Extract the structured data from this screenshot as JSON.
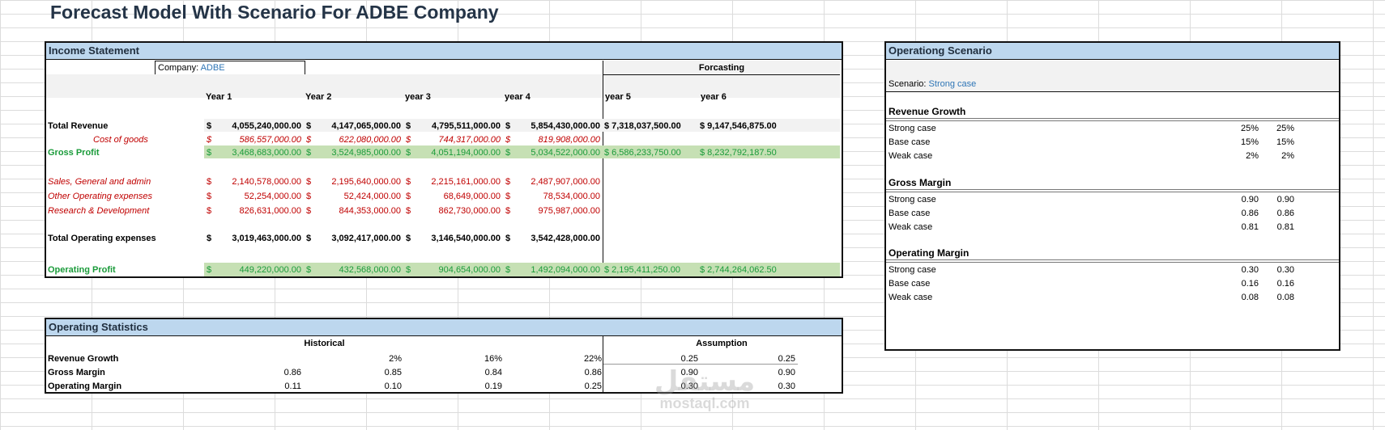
{
  "title": "Forecast Model With Scenario For ADBE Company",
  "income": {
    "header": "Income Statement",
    "company_label": "Company:",
    "company_value": "ADBE",
    "forecasting_label": "Forcasting",
    "years": [
      "Year 1",
      "Year 2",
      "year 3",
      "year 4",
      "year 5",
      "year 6"
    ],
    "rows": {
      "total_revenue": {
        "label": "Total Revenue",
        "values": [
          "4,055,240,000.00",
          "4,147,065,000.00",
          "4,795,511,000.00",
          "5,854,430,000.00",
          "7,318,037,500.00",
          "9,147,546,875.00"
        ]
      },
      "cost_of_goods": {
        "label": "Cost of goods",
        "values": [
          "586,557,000.00",
          "622,080,000.00",
          "744,317,000.00",
          "819,908,000.00"
        ]
      },
      "gross_profit": {
        "label": "Gross Profit",
        "values": [
          "3,468,683,000.00",
          "3,524,985,000.00",
          "4,051,194,000.00",
          "5,034,522,000.00",
          "6,586,233,750.00",
          "8,232,792,187.50"
        ]
      },
      "sga": {
        "label": "Sales, General and admin",
        "values": [
          "2,140,578,000.00",
          "2,195,640,000.00",
          "2,215,161,000.00",
          "2,487,907,000.00"
        ]
      },
      "other_opex": {
        "label": "Other Operating expenses",
        "values": [
          "52,254,000.00",
          "52,424,000.00",
          "68,649,000.00",
          "78,534,000.00"
        ]
      },
      "rnd": {
        "label": "Research & Development",
        "values": [
          "826,631,000.00",
          "844,353,000.00",
          "862,730,000.00",
          "975,987,000.00"
        ]
      },
      "total_opex": {
        "label": "Total Operating expenses",
        "values": [
          "3,019,463,000.00",
          "3,092,417,000.00",
          "3,146,540,000.00",
          "3,542,428,000.00"
        ]
      },
      "operating_profit": {
        "label": "Operating Profit",
        "values": [
          "449,220,000.00",
          "432,568,000.00",
          "904,654,000.00",
          "1,492,094,000.00",
          "2,195,411,250.00",
          "2,744,264,062.50"
        ]
      }
    }
  },
  "stats": {
    "header": "Operating Statistics",
    "historical_label": "Historical",
    "assumption_label": "Assumption",
    "rows": [
      {
        "label": "Revenue Growth",
        "values": [
          "",
          "2%",
          "16%",
          "22%",
          "0.25",
          "0.25"
        ]
      },
      {
        "label": "Gross Margin",
        "values": [
          "0.86",
          "0.85",
          "0.84",
          "0.86",
          "0.90",
          "0.90"
        ]
      },
      {
        "label": "Operating Margin",
        "values": [
          "0.11",
          "0.10",
          "0.19",
          "0.25",
          "0.30",
          "0.30"
        ]
      }
    ]
  },
  "scenario": {
    "header": "Operationg Scenario",
    "scenario_label": "Scenario:",
    "scenario_value": "Strong case",
    "sections": [
      {
        "title": "Revenue Growth",
        "rows": [
          {
            "label": "Strong case",
            "v1": "25%",
            "v2": "25%"
          },
          {
            "label": "Base case",
            "v1": "15%",
            "v2": "15%"
          },
          {
            "label": "Weak case",
            "v1": "2%",
            "v2": "2%"
          }
        ]
      },
      {
        "title": "Gross Margin",
        "rows": [
          {
            "label": "Strong case",
            "v1": "0.90",
            "v2": "0.90"
          },
          {
            "label": "Base case",
            "v1": "0.86",
            "v2": "0.86"
          },
          {
            "label": "Weak case",
            "v1": "0.81",
            "v2": "0.81"
          }
        ]
      },
      {
        "title": "Operating Margin",
        "rows": [
          {
            "label": "Strong case",
            "v1": "0.30",
            "v2": "0.30"
          },
          {
            "label": "Base case",
            "v1": "0.16",
            "v2": "0.16"
          },
          {
            "label": "Weak case",
            "v1": "0.08",
            "v2": "0.08"
          }
        ]
      }
    ]
  },
  "watermark": {
    "arabic": "مستقل",
    "latin": "mostaql.com"
  },
  "currency_symbol": "$",
  "colors": {
    "header_bg": "#bdd7ee",
    "green_band": "#c6e0b4",
    "red_text": "#c00000",
    "green_text": "#1a9b3a",
    "blue_text": "#2e75b6"
  }
}
